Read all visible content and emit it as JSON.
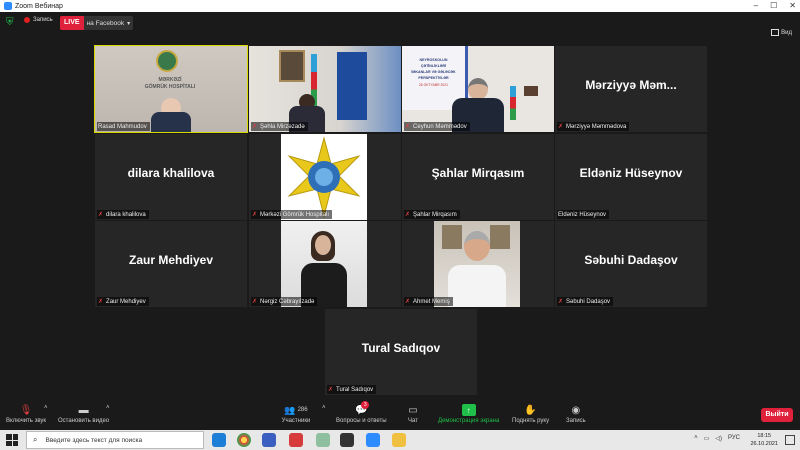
{
  "window": {
    "title": "Zoom Вебинар"
  },
  "topbar": {
    "recording_label": "Запись",
    "live_label": "LIVE",
    "live_target": "на Facebook",
    "view_label": "Вид"
  },
  "tiles": [
    {
      "big": "",
      "name": "Rasad Mahmudov",
      "muted": false
    },
    {
      "big": "",
      "name": "Şəhla Mirzəzadə",
      "muted": true
    },
    {
      "big": "",
      "name": "Ceyhun Məmmədov",
      "muted": true
    },
    {
      "big": "Mərziyyə  Məm...",
      "name": "Mərziyyə Məmmədova",
      "muted": true
    },
    {
      "big": "dilara khalilova",
      "name": "dilara khalilova",
      "muted": true
    },
    {
      "big": "",
      "name": "Mərkəzi Gömrük Hospitalı",
      "muted": true
    },
    {
      "big": "Şahlar Mirqasım",
      "name": "Şahlar Mirqasım",
      "muted": true
    },
    {
      "big": "Eldəniz Hüseynov",
      "name": "Eldəniz Hüseynov",
      "muted": false
    },
    {
      "big": "Zaur Mehdiyev",
      "name": "Zaur Mehdiyev",
      "muted": true
    },
    {
      "big": "",
      "name": "Nərgiz Cəbrayılzadə",
      "muted": true
    },
    {
      "big": "",
      "name": "Ahmet Memiş",
      "muted": true
    },
    {
      "big": "Səbuhi Dadaşov",
      "name": "Səbuhi Dadaşov",
      "muted": true
    },
    {
      "big": "Tural Sadıqov",
      "name": "Tural Sadıqov",
      "muted": true
    }
  ],
  "video_text": {
    "hospital_line1": "MƏRKƏZİ",
    "hospital_line2": "GÖMRÜK HOSPİTALI",
    "banner_line1": "NEYROSKOLUN",
    "banner_line2": "ÇƏTİNLİKLƏRİ",
    "banner_line3": "İMKANLAR VƏ GƏLƏCƏK",
    "banner_line4": "PERSPEKTİVLƏR",
    "banner_date": "26 OKTYABR 2021"
  },
  "toolbar": {
    "unmute": "Включить звук",
    "stop_video": "Остановить видео",
    "participants": "Участники",
    "participants_count": "286",
    "qa": "Вопросы и ответы",
    "qa_badge": "3",
    "chat": "Чат",
    "share": "Демонстрация экрана",
    "raise_hand": "Поднять руку",
    "record": "Запись",
    "leave": "Выйти"
  },
  "taskbar": {
    "search_placeholder": "Введите здесь текст для поиска",
    "lang": "РУС",
    "time": "18:15",
    "date": "26.10.2021"
  },
  "colors": {
    "active_speaker": "#d9d900",
    "live_red": "#e0213b",
    "share_green": "#1fbf4a"
  }
}
